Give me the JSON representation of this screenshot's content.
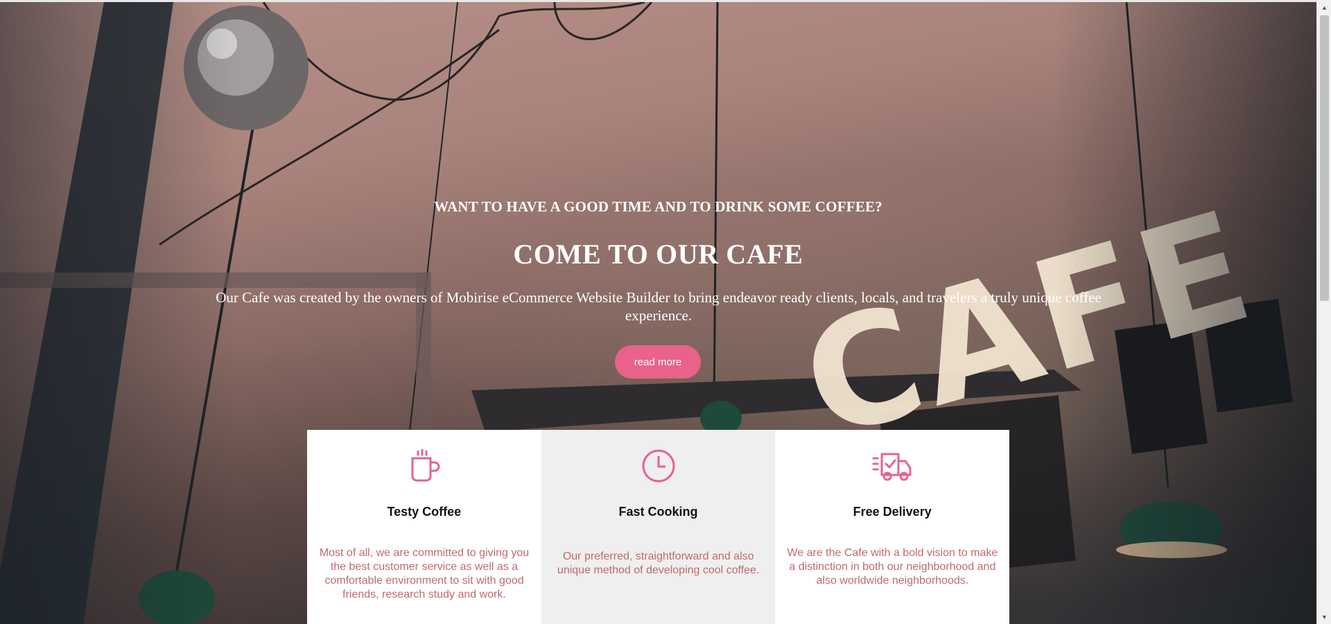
{
  "hero": {
    "kicker": "WANT TO HAVE A GOOD TIME AND TO DRINK SOME COFFEE?",
    "title": "COME TO OUR CAFE",
    "description": "Our Cafe was created by the owners of Mobirise eCommerce Website Builder to bring endeavor ready clients, locals, and travelers a truly unique coffee experience.",
    "button_label": "read more",
    "sign_letters": "CAFE"
  },
  "features": [
    {
      "icon": "coffee-cup-icon",
      "title": "Testy Coffee",
      "text": "Most of all, we are committed to giving you the best customer service as well as a comfortable environment to sit with good friends, research study and work."
    },
    {
      "icon": "clock-icon",
      "title": "Fast Cooking",
      "text": "Our preferred, straightforward and also unique method of developing cool coffee."
    },
    {
      "icon": "delivery-truck-icon",
      "title": "Free Delivery",
      "text": "We are the Cafe with a bold vision to make a distinction in both our neighborhood and also worldwide neighborhoods."
    }
  ],
  "colors": {
    "accent": "#e8628c",
    "feature_text": "#c06a6e",
    "feature_alt_bg": "#efefef"
  }
}
